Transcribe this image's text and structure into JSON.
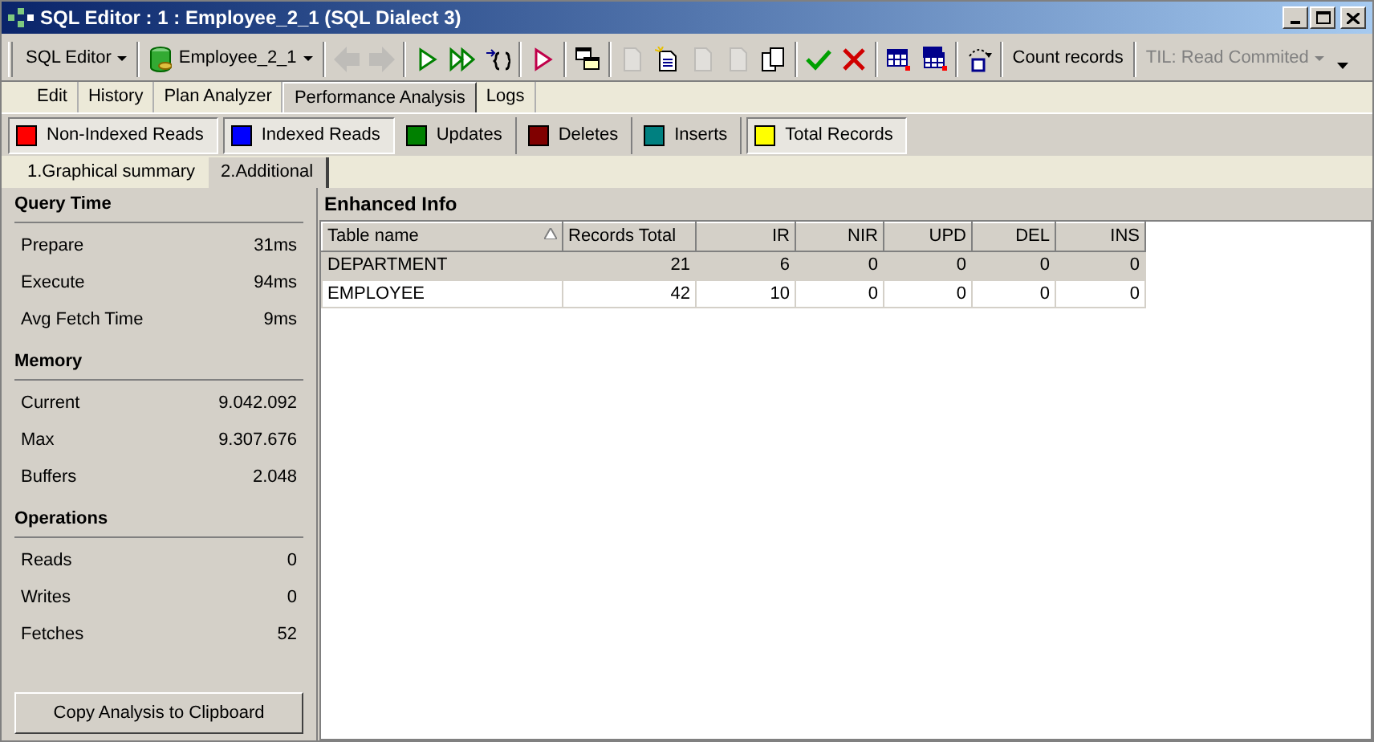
{
  "window": {
    "title": "SQL Editor : 1 : Employee_2_1 (SQL Dialect 3)"
  },
  "toolbar": {
    "items": [
      {
        "kind": "dropdown",
        "label": "SQL Editor",
        "disabled": false
      },
      {
        "kind": "database",
        "label": "Employee_2_1",
        "disabled": false
      },
      {
        "kind": "prev",
        "disabled": true
      },
      {
        "kind": "next",
        "disabled": true
      },
      {
        "kind": "run",
        "disabled": false
      },
      {
        "kind": "runall",
        "disabled": false
      },
      {
        "kind": "braces",
        "disabled": false
      },
      {
        "kind": "stop",
        "disabled": false
      },
      {
        "kind": "windows",
        "disabled": false
      },
      {
        "kind": "doc",
        "disabled": true
      },
      {
        "kind": "newdoc",
        "disabled": false
      },
      {
        "kind": "doc",
        "disabled": true
      },
      {
        "kind": "doc",
        "disabled": true
      },
      {
        "kind": "copy",
        "disabled": false
      },
      {
        "kind": "commit",
        "disabled": false
      },
      {
        "kind": "rollback",
        "disabled": false
      },
      {
        "kind": "grid",
        "disabled": false
      },
      {
        "kind": "grids",
        "disabled": false
      },
      {
        "kind": "reload",
        "disabled": false
      },
      {
        "kind": "text",
        "label": "Count records",
        "disabled": false
      },
      {
        "kind": "dropdown",
        "label": "TIL: Read Commited",
        "disabled": true
      }
    ]
  },
  "tabs": [
    {
      "label": "Edit",
      "selected": false
    },
    {
      "label": "History",
      "selected": false
    },
    {
      "label": "Plan Analyzer",
      "selected": false
    },
    {
      "label": "Performance Analysis",
      "selected": true
    },
    {
      "label": "Logs",
      "selected": false
    }
  ],
  "legend": [
    {
      "label": "Non-Indexed Reads",
      "color": "#ff0000",
      "checked": true
    },
    {
      "label": "Indexed Reads",
      "color": "#0000ff",
      "checked": true
    },
    {
      "label": "Updates",
      "color": "#008000",
      "checked": false
    },
    {
      "label": "Deletes",
      "color": "#800000",
      "checked": false
    },
    {
      "label": "Inserts",
      "color": "#008080",
      "checked": false
    },
    {
      "label": "Total Records",
      "color": "#ffff00",
      "checked": true
    }
  ],
  "subtabs": [
    {
      "label": "1.Graphical summary",
      "selected": false
    },
    {
      "label": "2.Additional",
      "selected": true
    }
  ],
  "sections": [
    {
      "title": "Query Time",
      "rows": [
        {
          "label": "Prepare",
          "value": "31ms"
        },
        {
          "label": "Execute",
          "value": "94ms"
        },
        {
          "label": "Avg Fetch Time",
          "value": "9ms"
        }
      ]
    },
    {
      "title": "Memory",
      "rows": [
        {
          "label": "Current",
          "value": "9.042.092"
        },
        {
          "label": "Max",
          "value": "9.307.676"
        },
        {
          "label": "Buffers",
          "value": "2.048"
        }
      ]
    },
    {
      "title": "Operations",
      "rows": [
        {
          "label": "Reads",
          "value": "0"
        },
        {
          "label": "Writes",
          "value": "0"
        },
        {
          "label": "Fetches",
          "value": "52"
        }
      ]
    }
  ],
  "copy_button": "Copy Analysis to Clipboard",
  "enhanced": {
    "title": "Enhanced Info",
    "columns": [
      "Table name",
      "Records Total",
      "IR",
      "NIR",
      "UPD",
      "DEL",
      "INS"
    ],
    "rows": [
      {
        "cells": [
          "DEPARTMENT",
          "21",
          "6",
          "0",
          "0",
          "0",
          "0"
        ],
        "selected": true
      },
      {
        "cells": [
          "EMPLOYEE",
          "42",
          "10",
          "0",
          "0",
          "0",
          "0"
        ],
        "selected": false
      }
    ]
  }
}
